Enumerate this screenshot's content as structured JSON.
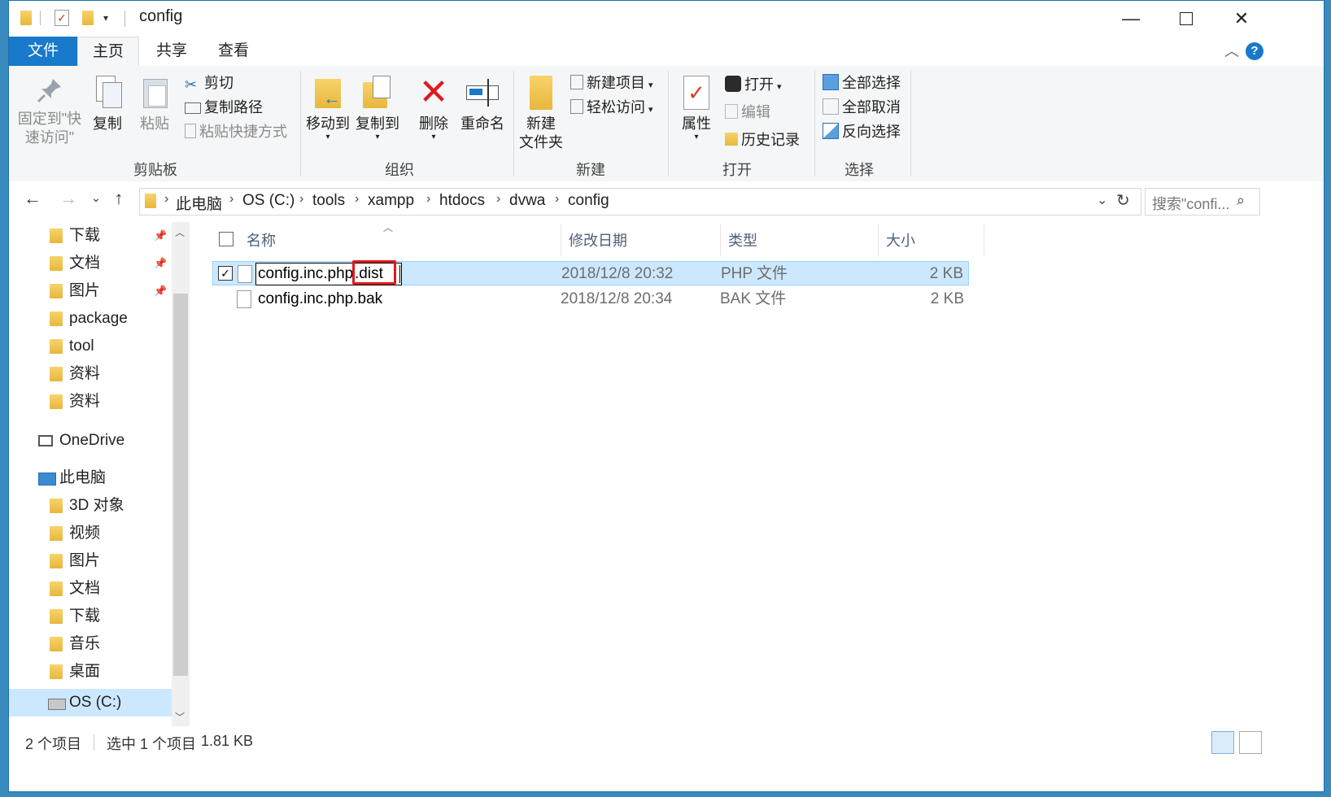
{
  "window": {
    "title": "config"
  },
  "tabs": {
    "file": "文件",
    "home": "主页",
    "share": "共享",
    "view": "查看"
  },
  "ribbon": {
    "clipboard": {
      "label": "剪贴板",
      "pin_line1": "固定到\"快",
      "pin_line2": "速访问\"",
      "copy": "复制",
      "paste": "粘贴",
      "cut": "剪切",
      "copy_path": "复制路径",
      "paste_shortcut": "粘贴快捷方式"
    },
    "organize": {
      "label": "组织",
      "move_to": "移动到",
      "copy_to": "复制到",
      "delete": "删除",
      "rename": "重命名"
    },
    "new": {
      "label": "新建",
      "new_folder_line1": "新建",
      "new_folder_line2": "文件夹",
      "new_item": "新建项目",
      "easy_access": "轻松访问"
    },
    "open": {
      "label": "打开",
      "properties": "属性",
      "open": "打开",
      "edit": "编辑",
      "history": "历史记录"
    },
    "select": {
      "label": "选择",
      "select_all": "全部选择",
      "select_none": "全部取消",
      "invert": "反向选择"
    }
  },
  "address": {
    "crumbs": [
      "此电脑",
      "OS (C:)",
      "tools",
      "xampp",
      "htdocs",
      "dvwa",
      "config"
    ],
    "search_placeholder": "搜索\"confi..."
  },
  "nav": {
    "quick": [
      "下载",
      "文档",
      "图片",
      "package",
      "tool",
      "资料",
      "资料"
    ],
    "onedrive": "OneDrive",
    "pc": "此电脑",
    "pc_items": [
      "3D 对象",
      "视频",
      "图片",
      "文档",
      "下载",
      "音乐",
      "桌面",
      "OS (C:)"
    ]
  },
  "columns": {
    "name": "名称",
    "date": "修改日期",
    "type": "类型",
    "size": "大小"
  },
  "files": [
    {
      "name_base": "config.inc.php",
      "name_ext": ".dist",
      "date": "2018/12/8 20:32",
      "type": "PHP 文件",
      "size": "2 KB",
      "selected": true
    },
    {
      "name": "config.inc.php.bak",
      "date": "2018/12/8 20:34",
      "type": "BAK 文件",
      "size": "2 KB",
      "selected": false
    }
  ],
  "status": {
    "count": "2 个项目",
    "selected": "选中 1 个项目",
    "size": "1.81 KB"
  },
  "colors": {
    "accent": "#1979ca",
    "selection": "#cce8ff",
    "highlight_box": "#e0191e"
  }
}
